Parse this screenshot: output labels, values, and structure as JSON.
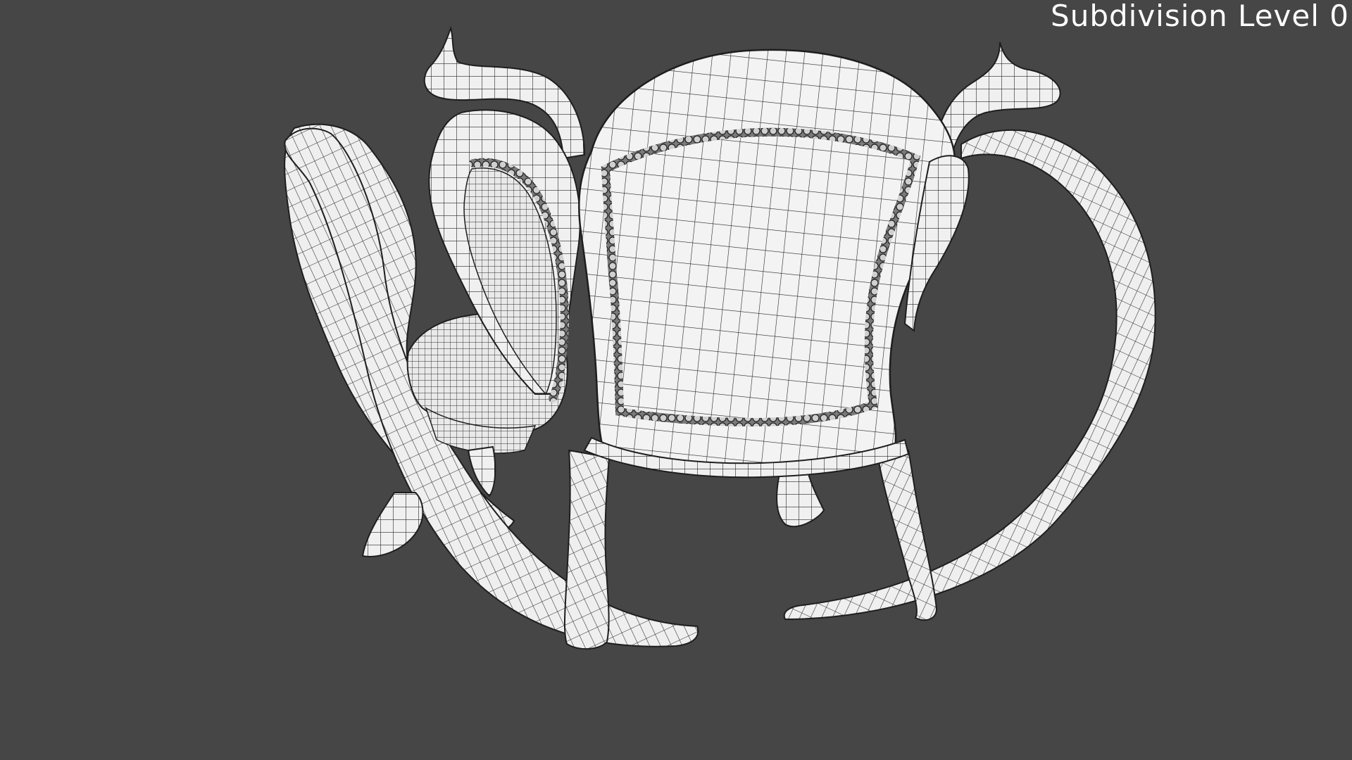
{
  "viewport": {
    "background_color": "#464646",
    "overlay_label": "Subdivision Level 0"
  },
  "model": {
    "subject": "armchair-wireframe",
    "shading_color": "#f2f2f2",
    "wire_color": "#222222"
  }
}
